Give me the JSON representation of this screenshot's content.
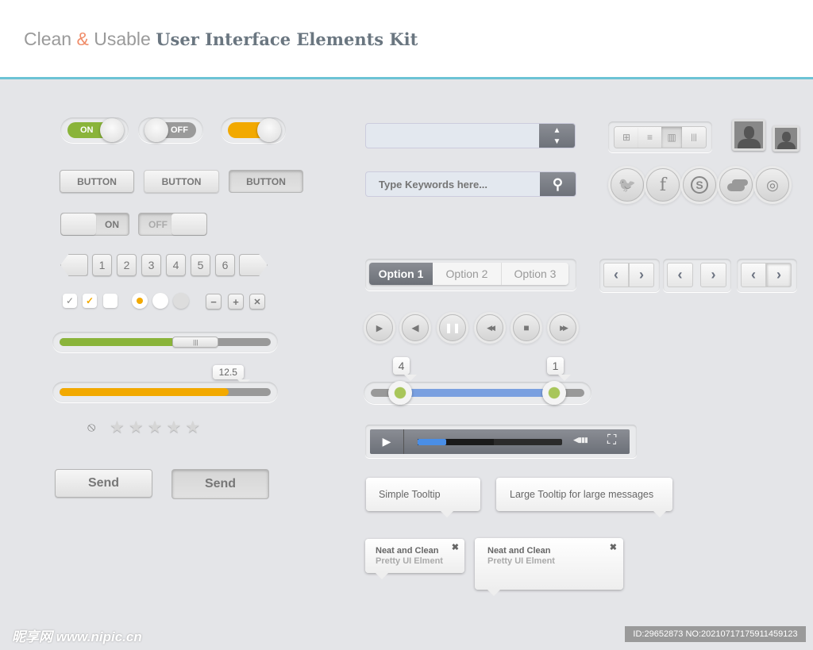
{
  "header": {
    "title_part1": "Clean ",
    "title_amp": "&",
    "title_part2": " Usable ",
    "title_bold": "User Interface Elements Kit",
    "accent": "#6cc3d5"
  },
  "toggles": [
    {
      "label": "ON",
      "state": "on",
      "color": "#8ab43a"
    },
    {
      "label": "OFF",
      "state": "off",
      "color": "#9a9a9a"
    },
    {
      "label": "",
      "state": "on",
      "color": "#f2a900"
    }
  ],
  "buttons": [
    {
      "label": "BUTTON",
      "state": "normal"
    },
    {
      "label": "BUTTON",
      "state": "hover"
    },
    {
      "label": "BUTTON",
      "state": "pressed"
    }
  ],
  "switches": [
    {
      "label": "ON"
    },
    {
      "label": "OFF"
    }
  ],
  "pagination": {
    "pages": [
      "1",
      "2",
      "3",
      "4",
      "5",
      "6"
    ]
  },
  "checkboxes": [
    {
      "checked": true,
      "mark": "✓"
    },
    {
      "checked": true,
      "mark": "✓",
      "color": "#f2a900"
    },
    {
      "checked": false,
      "mark": ""
    }
  ],
  "radios": [
    {
      "selected": true
    },
    {
      "selected": false
    },
    {
      "selected": false
    }
  ],
  "small_buttons": [
    {
      "icon": "minus-icon",
      "glyph": "−"
    },
    {
      "icon": "plus-icon",
      "glyph": "+"
    },
    {
      "icon": "close-icon",
      "glyph": "✕"
    }
  ],
  "slider_green": {
    "percent": 55,
    "color": "#8ab43a"
  },
  "slider_orange": {
    "percent": 80,
    "value": "12.5",
    "color": "#f2a900"
  },
  "rating": {
    "stars": 5,
    "value": 0,
    "clear_glyph": "⦸",
    "star_glyph": "★"
  },
  "send_buttons": [
    {
      "label": "Send"
    },
    {
      "label": "Send"
    }
  ],
  "select": {
    "value": "",
    "icon": "updown-icon"
  },
  "search": {
    "placeholder": "Type Keywords here...",
    "icon": "search-icon",
    "glyph": "⚲"
  },
  "view_switcher": [
    {
      "icon": "grid-icon",
      "glyph": "⊞"
    },
    {
      "icon": "list-icon",
      "glyph": "≡"
    },
    {
      "icon": "columns-icon",
      "glyph": "▥"
    },
    {
      "icon": "barcode-icon",
      "glyph": "|||"
    }
  ],
  "social": [
    {
      "icon": "twitter-icon",
      "glyph": "🐦"
    },
    {
      "icon": "facebook-icon",
      "glyph": "f"
    },
    {
      "icon": "skype-icon",
      "glyph": "S"
    },
    {
      "icon": "cloud-icon",
      "glyph": ""
    },
    {
      "icon": "dribbble-icon",
      "glyph": "◎"
    }
  ],
  "segmented": [
    {
      "label": "Option 1",
      "active": true
    },
    {
      "label": "Option 2"
    },
    {
      "label": "Option 3"
    }
  ],
  "arrows": {
    "left": "‹",
    "right": "›"
  },
  "media": [
    {
      "icon": "play-icon",
      "glyph": "▶"
    },
    {
      "icon": "volume-icon",
      "glyph": "◀"
    },
    {
      "icon": "pause-icon",
      "glyph": "❚❚"
    },
    {
      "icon": "rewind-icon",
      "glyph": "◀◀"
    },
    {
      "icon": "stop-icon",
      "glyph": "■"
    },
    {
      "icon": "fast-forward-icon",
      "glyph": "▶▶"
    }
  ],
  "range_slider": {
    "low": "4",
    "high": "1",
    "color": "#7aa0e0",
    "handle_color": "#a8c65a"
  },
  "video_player": {
    "play_glyph": "▶",
    "played_percent": 20,
    "buffered_percent": 53,
    "volume_glyph": "◀▮▮▮",
    "fullscreen_glyph": "⛶"
  },
  "tooltips": [
    {
      "text": "Simple Tooltip"
    },
    {
      "text": "Large Tooltip for large messages"
    }
  ],
  "notifications": [
    {
      "title": "Neat and Clean",
      "subtitle": "Pretty UI Elment",
      "close": "✖"
    },
    {
      "title": "Neat and Clean",
      "subtitle": "Pretty UI Elment",
      "close": "✖"
    }
  ],
  "watermark": {
    "logo": "昵享网 www.nipic.cn",
    "id": "ID:29652873 NO:20210717175911459123"
  }
}
